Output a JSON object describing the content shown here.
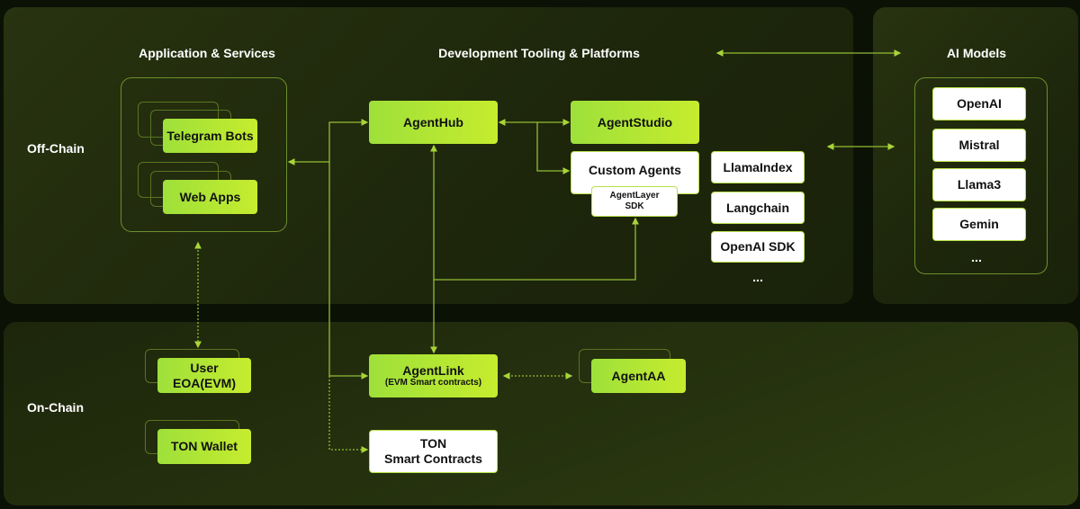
{
  "sections": {
    "app_services": "Application & Services",
    "dev_tooling": "Development Tooling & Platforms",
    "ai_models": "AI Models",
    "off_chain": "Off-Chain",
    "on_chain": "On-Chain"
  },
  "apps": {
    "telegram": "Telegram Bots",
    "web": "Web Apps"
  },
  "tooling": {
    "agenthub": "AgentHub",
    "agentstudio": "AgentStudio",
    "custom_agents": "Custom Agents",
    "sdk_line1": "AgentLayer",
    "sdk_line2": "SDK",
    "frameworks": [
      "LlamaIndex",
      "Langchain",
      "OpenAI SDK"
    ],
    "more": "..."
  },
  "models": {
    "items": [
      "OpenAI",
      "Mistral",
      "Llama3",
      "Gemin"
    ],
    "more": "..."
  },
  "onchain": {
    "user_line1": "User",
    "user_line2": "EOA(EVM)",
    "ton_wallet": "TON Wallet",
    "agentlink": "AgentLink",
    "agentlink_sub": "(EVM Smart contracts)",
    "agentaa": "AgentAA",
    "ton_sc_line1": "TON",
    "ton_sc_line2": "Smart Contracts"
  },
  "colors": {
    "accent": "#b4e534",
    "panel": "#232d0d",
    "background": "#0c1106"
  }
}
